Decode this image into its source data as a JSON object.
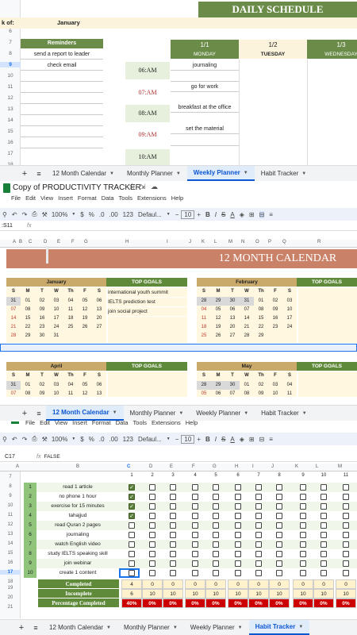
{
  "daily": {
    "week_label": "k of:",
    "month": "January",
    "title": "DAILY SCHEDULE",
    "reminders_header": "Reminders",
    "reminders": [
      "send a report to leader",
      "check email"
    ],
    "row_numbers": [
      "6",
      "7",
      "8",
      "9",
      "10",
      "11",
      "12",
      "13",
      "14",
      "15",
      "16",
      "17",
      "18"
    ],
    "days": [
      {
        "date": "1/1",
        "name": "MONDAY"
      },
      {
        "date": "1/2",
        "name": "TUESDAY"
      },
      {
        "date": "1/3",
        "name": "WEDNESDAY"
      }
    ],
    "times": [
      "06:AM",
      "07:AM",
      "08:AM",
      "09:AM",
      "10:AM"
    ],
    "tasks": [
      "journaling",
      "go for work",
      "breakfast at the office",
      "set the material"
    ]
  },
  "tabs1": [
    "12 Month Calendar",
    "Monthly Planner",
    "Weekly Planner",
    "Habit Tracker"
  ],
  "doc": {
    "title": "Copy of PRODUCTIVITY TRACKER",
    "menu": [
      "File",
      "Edit",
      "View",
      "Insert",
      "Format",
      "Data",
      "Tools",
      "Extensions",
      "Help"
    ],
    "zoom": "100%",
    "font": "Defaul...",
    "size": "10",
    "cell_ref": ":S11",
    "cols": [
      "A",
      "B",
      "C",
      "D",
      "E",
      "F",
      "G",
      "H",
      "I",
      "J",
      "K",
      "L",
      "M",
      "N",
      "O",
      "P",
      "Q",
      "R"
    ]
  },
  "calendar": {
    "title": "12 MONTH CALENDAR",
    "goals_header": "TOP GOALS",
    "dow": [
      "S",
      "M",
      "T",
      "W",
      "Th",
      "F",
      "S"
    ],
    "january": {
      "name": "January",
      "weeks": [
        [
          "31",
          "01",
          "02",
          "03",
          "04",
          "05",
          "06"
        ],
        [
          "07",
          "08",
          "09",
          "10",
          "11",
          "12",
          "13"
        ],
        [
          "14",
          "15",
          "16",
          "17",
          "18",
          "19",
          "20"
        ],
        [
          "21",
          "22",
          "23",
          "24",
          "25",
          "26",
          "27"
        ],
        [
          "28",
          "29",
          "30",
          "31",
          "",
          "",
          ""
        ]
      ],
      "goals": [
        "international youth summit",
        "IELTS prediction test",
        "join social project"
      ]
    },
    "february": {
      "name": "February",
      "weeks": [
        [
          "28",
          "29",
          "30",
          "31",
          "01",
          "02",
          "03"
        ],
        [
          "04",
          "05",
          "06",
          "07",
          "08",
          "09",
          "10"
        ],
        [
          "11",
          "12",
          "13",
          "14",
          "15",
          "16",
          "17"
        ],
        [
          "18",
          "19",
          "20",
          "21",
          "22",
          "23",
          "24"
        ],
        [
          "25",
          "26",
          "27",
          "28",
          "29",
          "",
          ""
        ]
      ]
    },
    "april": {
      "name": "April",
      "weeks": [
        [
          "31",
          "01",
          "02",
          "03",
          "04",
          "05",
          "06"
        ],
        [
          "07",
          "08",
          "09",
          "10",
          "11",
          "12",
          "13"
        ]
      ]
    },
    "may": {
      "name": "May",
      "weeks": [
        [
          "28",
          "29",
          "30",
          "01",
          "02",
          "03",
          "04"
        ],
        [
          "05",
          "06",
          "07",
          "08",
          "09",
          "10",
          "11"
        ]
      ]
    }
  },
  "tabs2": [
    "12 Month Calendar",
    "Monthly Planner",
    "Weekly Planner",
    "Habit Tracker"
  ],
  "doc2": {
    "menu": [
      "File",
      "Edit",
      "View",
      "Insert",
      "Format",
      "Data",
      "Tools",
      "Extensions",
      "Help"
    ],
    "zoom": "100%",
    "font": "Defaul...",
    "size": "10",
    "cell_ref": "C17",
    "formula": "FALSE",
    "cols": [
      "A",
      "B",
      "C",
      "D",
      "E",
      "F",
      "G",
      "H",
      "I",
      "J",
      "K",
      "L",
      "M"
    ]
  },
  "habits": {
    "day_numbers": [
      "1",
      "2",
      "3",
      "4",
      "5",
      "6",
      "7",
      "8",
      "9",
      "10",
      "11"
    ],
    "row_numbers": [
      "7",
      "8",
      "9",
      "10",
      "11",
      "12",
      "13",
      "14",
      "15",
      "16",
      "17",
      "18",
      "19",
      "20",
      "21"
    ],
    "items": [
      {
        "n": "1",
        "name": "read 1 article",
        "c": true
      },
      {
        "n": "2",
        "name": "no phone 1 hour",
        "c": true
      },
      {
        "n": "3",
        "name": "exercise for 15 minutes",
        "c": true
      },
      {
        "n": "4",
        "name": "tahajjud",
        "c": true
      },
      {
        "n": "5",
        "name": "read Quran 2 pages",
        "c": false
      },
      {
        "n": "6",
        "name": "journaling",
        "c": false
      },
      {
        "n": "7",
        "name": "watch English video",
        "c": false
      },
      {
        "n": "8",
        "name": "study IELTS speaking skill",
        "c": false
      },
      {
        "n": "9",
        "name": "join webinar",
        "c": false
      },
      {
        "n": "10",
        "name": "create 1 content",
        "c": false
      }
    ],
    "completed_label": "Completed",
    "incomplete_label": "Incomplete",
    "percentage_label": "Percentage Completed",
    "completed": [
      "4",
      "0",
      "0",
      "0",
      "0",
      "0",
      "0",
      "0",
      "0",
      "0",
      "0"
    ],
    "incomplete": [
      "6",
      "10",
      "10",
      "10",
      "10",
      "10",
      "10",
      "10",
      "10",
      "10",
      "10"
    ],
    "percentage": [
      "40%",
      "0%",
      "0%",
      "0%",
      "0%",
      "0%",
      "0%",
      "0%",
      "0%",
      "0%",
      "0%"
    ]
  },
  "tabs3": [
    "12 Month Calendar",
    "Monthly Planner",
    "Weekly Planner",
    "Habit Tracker"
  ]
}
